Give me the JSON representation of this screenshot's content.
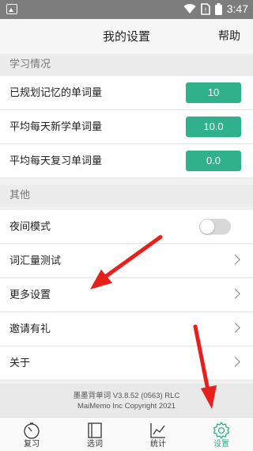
{
  "status_bar": {
    "time": "3:47"
  },
  "header": {
    "title": "我的设置",
    "help": "帮助"
  },
  "sections": {
    "study": {
      "title": "学习情况",
      "rows": [
        {
          "label": "已规划记忆的单词量",
          "value": "10"
        },
        {
          "label": "平均每天新学单词量",
          "value": "10.0"
        },
        {
          "label": "平均每天复习单词量",
          "value": "0.0"
        }
      ]
    },
    "other": {
      "title": "其他",
      "night_mode": {
        "label": "夜间模式",
        "enabled": false
      },
      "rows": [
        {
          "label": "词汇量测试"
        },
        {
          "label": "更多设置"
        },
        {
          "label": "邀请有礼"
        },
        {
          "label": "关于"
        }
      ]
    }
  },
  "footer": {
    "line1": "墨墨背单词 V3.8.52 (0563) RLC",
    "line2": "MaiMemo Inc Copyright 2021"
  },
  "tabs": [
    {
      "label": "复习",
      "icon": "clock-icon",
      "active": false
    },
    {
      "label": "选词",
      "icon": "book-icon",
      "active": false
    },
    {
      "label": "统计",
      "icon": "chart-icon",
      "active": false
    },
    {
      "label": "设置",
      "icon": "gear-icon",
      "active": true
    }
  ],
  "colors": {
    "accent": "#2fb28b",
    "annotation_arrow": "#e8201c",
    "status_bar": "#7d7d7d"
  }
}
